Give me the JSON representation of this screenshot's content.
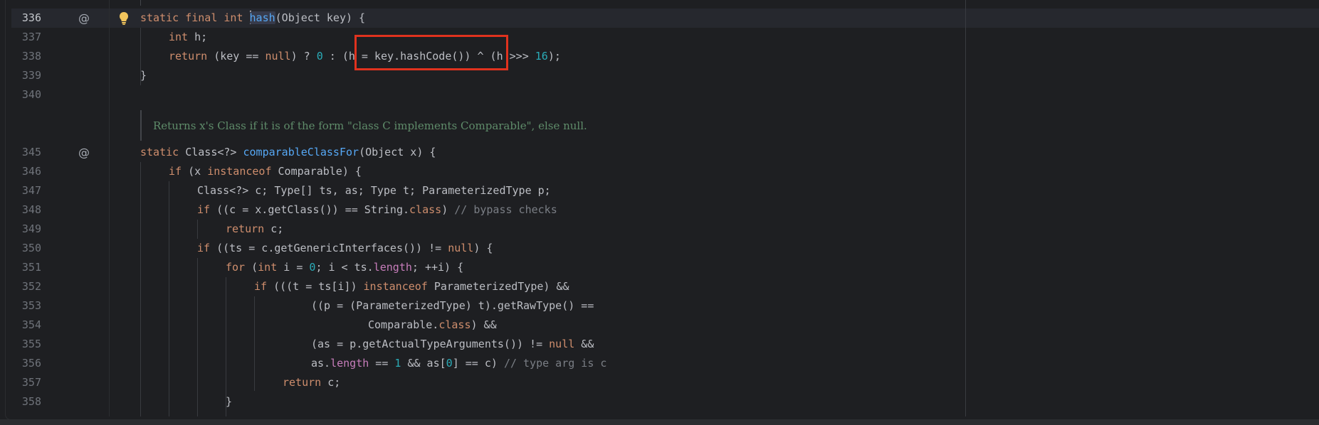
{
  "editor": {
    "lines": [
      {
        "n": "336",
        "icon": "@",
        "active": true
      },
      {
        "n": "337"
      },
      {
        "n": "338"
      },
      {
        "n": "339"
      },
      {
        "n": "340"
      },
      {
        "n": "345",
        "icon": "@"
      },
      {
        "n": "346"
      },
      {
        "n": "347"
      },
      {
        "n": "348"
      },
      {
        "n": "349"
      },
      {
        "n": "350"
      },
      {
        "n": "351"
      },
      {
        "n": "352"
      },
      {
        "n": "353"
      },
      {
        "n": "354"
      },
      {
        "n": "355"
      },
      {
        "n": "356"
      },
      {
        "n": "357"
      },
      {
        "n": "358"
      }
    ],
    "code": {
      "l336": {
        "static": "static",
        "final": "final",
        "int": "int",
        "hash": "hash",
        "rest": "(Object key) {"
      },
      "l337": {
        "int": "int",
        "rest": " h;"
      },
      "l338": {
        "return": "return",
        "a": " (key == ",
        "null": "null",
        "b": ") ? ",
        "zero": "0",
        "c": " : (h = key.hashCode()) ^ (h >>> ",
        "sixteen": "16",
        "d": ");"
      },
      "l339": {
        "text": "}"
      },
      "doc_comment": "Returns x's Class if it is of the form \"class C implements Comparable\", else null.",
      "l345": {
        "static": "static",
        "a": " Class<?> ",
        "fn": "comparableClassFor",
        "b": "(Object x) {"
      },
      "l346": {
        "if": "if",
        "a": " (x ",
        "instanceof": "instanceof",
        "b": " Comparable) {"
      },
      "l347": {
        "text": "Class<?> c; Type[] ts, as; Type t; ParameterizedType p;"
      },
      "l348": {
        "if": "if",
        "a": " ((c = x.getClass()) == String.",
        "class": "class",
        "b": ") ",
        "comment": "// bypass checks"
      },
      "l349": {
        "return": "return",
        "a": " c;"
      },
      "l350": {
        "if": "if",
        "a": " ((ts = c.getGenericInterfaces()) != ",
        "null": "null",
        "b": ") {"
      },
      "l351": {
        "for": "for",
        "a": " (",
        "int": "int",
        "b": " i = ",
        "zero": "0",
        "c": "; i < ts.",
        "length": "length",
        "d": "; ++i) {"
      },
      "l352": {
        "if": "if",
        "a": " (((t = ts[i]) ",
        "instanceof": "instanceof",
        "b": " ParameterizedType) &&"
      },
      "l353": {
        "text": "((p = (ParameterizedType) t).getRawType() =="
      },
      "l354": {
        "a": "Comparable.",
        "class": "class",
        "b": ") &&"
      },
      "l355": {
        "a": "(as = p.getActualTypeArguments()) != ",
        "null": "null",
        "b": " &&"
      },
      "l356": {
        "a": "as.",
        "length": "length",
        "b": " == ",
        "one": "1",
        "c": " && as[",
        "zero": "0",
        "d": "] == c) ",
        "comment": "// type arg is c"
      },
      "l357": {
        "return": "return",
        "a": " c;"
      },
      "l358": {
        "text": "}"
      }
    }
  },
  "colors": {
    "background": "#1e1f22",
    "keyword": "#cf8e6d",
    "function": "#56a8f5",
    "number": "#2aacb8",
    "field": "#c77dbb",
    "comment": "#7a7e85",
    "doc": "#5f8c6a",
    "highlight_box": "#e0321e"
  },
  "icons": {
    "override": "at-sign-icon",
    "intention": "lightbulb-icon"
  }
}
